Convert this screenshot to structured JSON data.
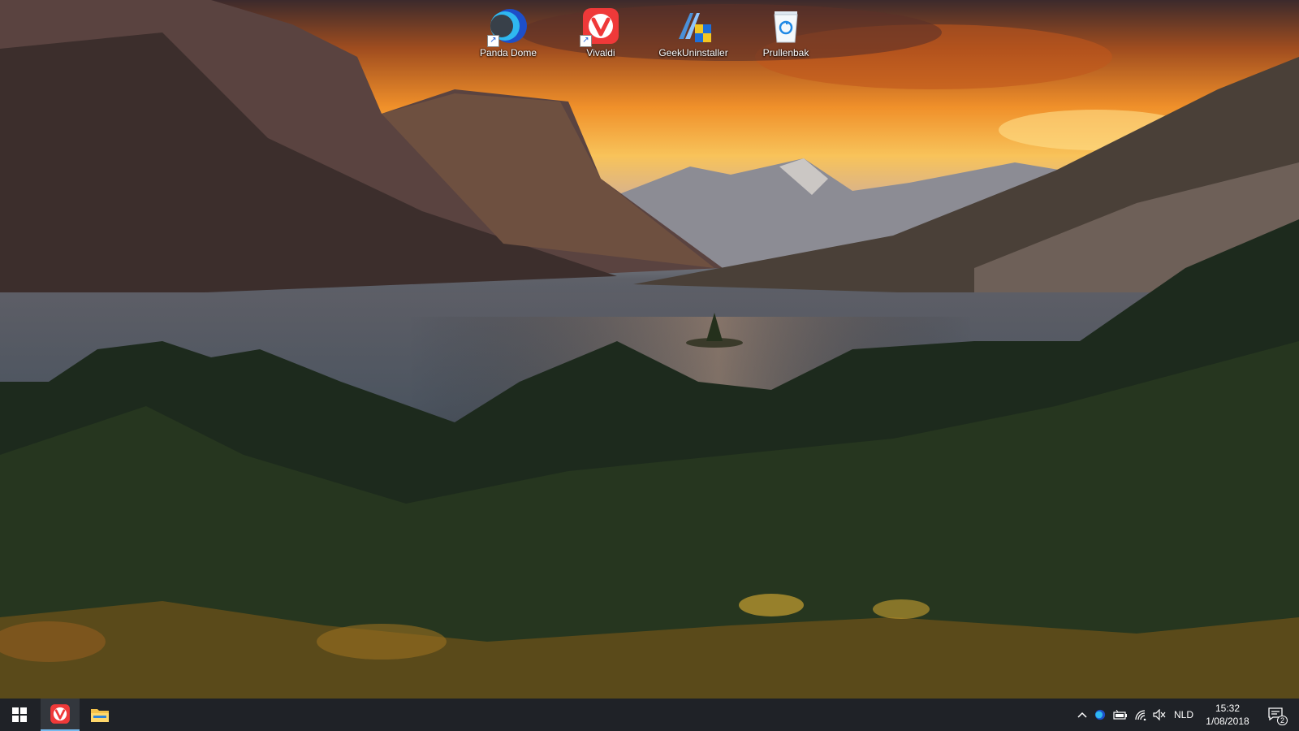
{
  "desktop": {
    "icons": [
      {
        "label": "Panda Dome",
        "icon": "panda-dome-icon",
        "shortcut": true
      },
      {
        "label": "Vivaldi",
        "icon": "vivaldi-icon",
        "shortcut": true
      },
      {
        "label": "GeekUninstaller",
        "icon": "geekuninstaller-icon",
        "shortcut": false
      },
      {
        "label": "Prullenbak",
        "icon": "recycle-bin-icon",
        "shortcut": false
      }
    ]
  },
  "taskbar": {
    "start_icon": "windows-logo-icon",
    "pinned": [
      {
        "name": "Vivaldi",
        "icon": "vivaldi-icon",
        "active": true
      },
      {
        "name": "File Explorer",
        "icon": "folder-icon",
        "active": false
      }
    ],
    "tray": {
      "language": "NLD",
      "time": "15:32",
      "date": "1/08/2018",
      "notification_count": "2"
    }
  },
  "colors": {
    "taskbar_bg": "#1f2227",
    "vivaldi_red": "#ef3939",
    "accent": "#76b9ed"
  }
}
